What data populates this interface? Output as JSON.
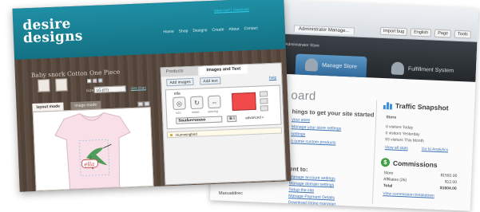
{
  "back": {
    "tab_title": "Administrator Manage...",
    "tools": [
      "Import bug",
      "English",
      "Page",
      "Tools"
    ],
    "site_label": "Administrator Store",
    "nav": [
      {
        "label": "Manage Store",
        "active": true
      },
      {
        "label": "Fulfillment System",
        "active": false
      }
    ],
    "heading": "oard",
    "subheading": "hings to get your site started",
    "links": [
      "your store",
      "Manage your store settings",
      "settings",
      "n some custom products"
    ],
    "subheading2": "ent to:",
    "links2": [
      "Manage account settings",
      "Manage domain settings",
      "Setup the site",
      "Manage Payment Details",
      "Download listing manager"
    ],
    "traffic": {
      "title": "Traffic Snapshot",
      "label": "Store",
      "lines": [
        "0 visitors Today",
        "0 visitors Yesterday",
        "93 visitors This Month"
      ],
      "links": [
        "View all stats",
        "Go to Analytics"
      ]
    },
    "commissions": {
      "title": "Commissions",
      "rows": [
        {
          "label": "Store",
          "value": "$1592.00"
        },
        {
          "label": "Affiliates (26)",
          "value": "$12.00"
        },
        {
          "label": "Total",
          "value": "$1604.00"
        }
      ],
      "link": "View commission breakdown"
    }
  },
  "front": {
    "logo_line1": "desire",
    "logo_line2": "designs",
    "cart_link": "view cart | checkout",
    "nav": [
      "Home",
      "Shop",
      "Designs",
      "Create",
      "About",
      "Contact"
    ],
    "product_title": "Baby snork Cotton One Piece",
    "size_label": "Size",
    "size_value": "LG (0?)",
    "size_chart": "size chart",
    "left_tabs": [
      "layout mode",
      "image mode"
    ],
    "panel_tabs": [
      "Products",
      "Images and Text"
    ],
    "add_images": "Add images",
    "add_text": "Add text",
    "help": "help",
    "item_title": "ella",
    "knob_labels": [
      "size",
      "rotate",
      "spacing"
    ],
    "font_value": "Snakerunno",
    "bold_italic": "B I",
    "advanced": "advanced »",
    "list_item": "Hummingbird",
    "canvas_text": "ella"
  },
  "caption": "Manualdirec",
  "colors": {
    "teal_header": "#1f8fa5",
    "wood": "#5b4b40",
    "accent_red": "#f04a4a",
    "nav_blue": "#2f6a9b",
    "link_blue": "#3b73b5"
  }
}
